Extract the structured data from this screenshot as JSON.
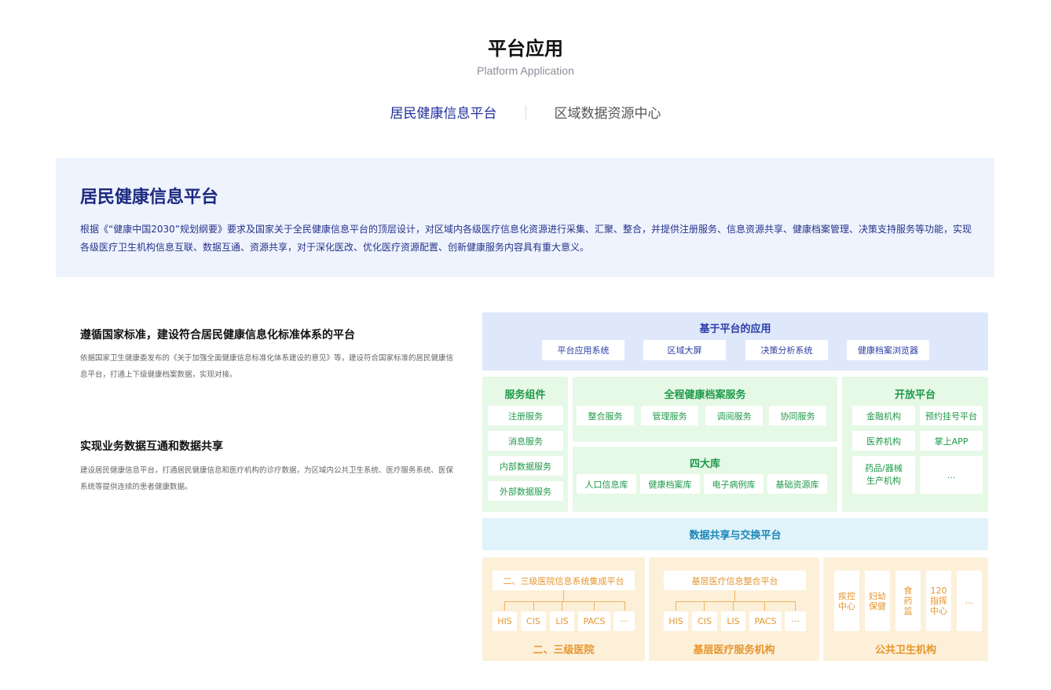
{
  "header": {
    "title": "平台应用",
    "subtitle": "Platform Application"
  },
  "tabs": [
    {
      "label": "居民健康信息平台",
      "active": true
    },
    {
      "label": "区域数据资源中心",
      "active": false
    }
  ],
  "intro": {
    "title": "居民健康信息平台",
    "text": "根据《“健康中国2030”规划纲要》要求及国家关于全民健康信息平台的顶层设计，对区域内各级医疗信息化资源进行采集、汇聚、整合，并提供注册服务、信息资源共享、健康档案管理、决策支持服务等功能，实现各级医疗卫生机构信息互联、数据互通、资源共享，对于深化医改、优化医疗资源配置、创新健康服务内容具有重大意义。"
  },
  "features": [
    {
      "title": "遵循国家标准，建设符合居民健康信息化标准体系的平台",
      "text": "依据国家卫生健康委发布的《关于加强全面健康信息标准化体系建设的意见》等，建设符合国家标准的居民健康信息平台，打通上下级健康档案数据，实现对接。"
    },
    {
      "title": "实现业务数据互通和数据共享",
      "text": "建设居民健康信息平台，打通居民健康信息和医疗机构的诊疗数据，为区域内公共卫生系统、医疗服务系统、医保系统等提供连续的患者健康数据。"
    }
  ],
  "diagram": {
    "apps": {
      "title": "基于平台的应用",
      "items": [
        "平台应用系统",
        "区域大屏",
        "决策分析系统",
        "健康档案浏览器"
      ]
    },
    "services": {
      "title": "服务组件",
      "items": [
        "注册服务",
        "消息服务",
        "内部数据服务",
        "外部数据服务"
      ]
    },
    "ehr": {
      "title": "全程健康档案服务",
      "items": [
        "整合服务",
        "管理服务",
        "调阅服务",
        "协同服务"
      ]
    },
    "four_db": {
      "title": "四大库",
      "items": [
        "人口信息库",
        "健康档案库",
        "电子病例库",
        "基础资源库"
      ]
    },
    "open": {
      "title": "开放平台",
      "items": [
        "金融机构",
        "预约挂号平台",
        "医养机构",
        "掌上APP",
        "药品/器械\n生产机构",
        "..."
      ]
    },
    "exchange": {
      "title": "数据共享与交换平台"
    },
    "hospitals": {
      "title": "二、三级医院",
      "platform": "二、三级医院信息系统集成平台",
      "systems": [
        "HIS",
        "CIS",
        "LIS",
        "PACS",
        "···"
      ]
    },
    "primary": {
      "title": "基层医疗服务机构",
      "platform": "基层医疗信息整合平台",
      "systems": [
        "HIS",
        "CIS",
        "LIS",
        "PACS",
        "···"
      ]
    },
    "public_health": {
      "title": "公共卫生机构",
      "items": [
        "疾控\n中心",
        "妇幼\n保健",
        "食\n药\n监",
        "120\n指挥\n中心",
        "..."
      ]
    }
  }
}
